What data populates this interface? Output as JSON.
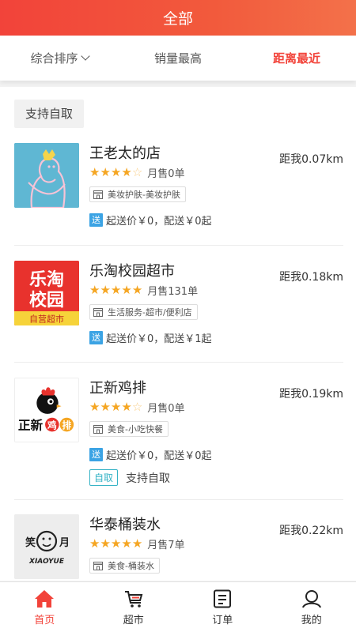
{
  "header": {
    "title": "全部"
  },
  "sort_tabs": [
    {
      "label": "综合排序",
      "active": false
    },
    {
      "label": "销量最高",
      "active": false
    },
    {
      "label": "距离最近",
      "active": true
    }
  ],
  "filter_chip": {
    "label": "支持自取"
  },
  "stores": [
    {
      "name": "王老太的店",
      "distance": "距我0.07km",
      "rating": 4,
      "sales": "月售0单",
      "category": "美妆护肤-美妆护肤",
      "delivery_tag": "送",
      "delivery": "起送价￥0，配送￥0起"
    },
    {
      "name": "乐淘校园超市",
      "distance": "距我0.18km",
      "rating": 5,
      "sales": "月售131单",
      "category": "生活服务-超市/便利店",
      "delivery_tag": "送",
      "delivery": "起送价￥0，配送￥1起",
      "logo_text": {
        "line1": "乐淘",
        "line2": "校园",
        "line3": "自营超市"
      }
    },
    {
      "name": "正新鸡排",
      "distance": "距我0.19km",
      "rating": 4,
      "sales": "月售0单",
      "category": "美食-小吃快餐",
      "delivery_tag": "送",
      "delivery": "起送价￥0，配送￥0起",
      "pickup_tag": "自取",
      "pickup_label": "支持自取",
      "logo_text": {
        "part1": "正新",
        "part2": "鸡",
        "part3": "排"
      }
    },
    {
      "name": "华泰桶装水",
      "distance": "距我0.22km",
      "rating": 5,
      "sales": "月售7单",
      "category": "美食-桶装水",
      "logo_text": {
        "left": "笑",
        "right": "月",
        "bottom": "XIAOYUE"
      }
    }
  ],
  "tabbar": [
    {
      "label": "首页",
      "icon": "home-icon",
      "active": true
    },
    {
      "label": "超市",
      "icon": "cart-icon",
      "active": false
    },
    {
      "label": "订单",
      "icon": "order-icon",
      "active": false
    },
    {
      "label": "我的",
      "icon": "user-icon",
      "active": false
    }
  ],
  "colors": {
    "accent": "#f2433a",
    "star": "#f5a623",
    "send_tag": "#3ba3e4",
    "pickup": "#36b3c6"
  }
}
